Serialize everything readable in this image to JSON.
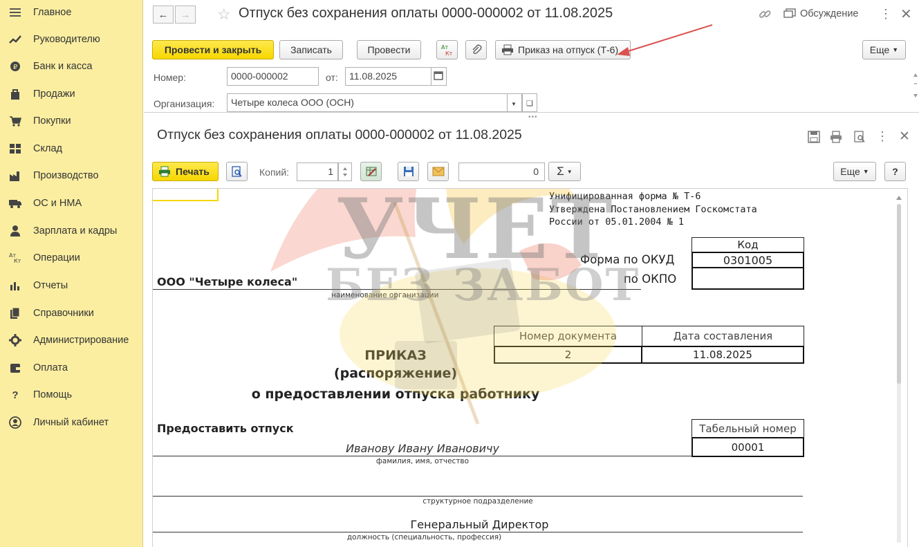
{
  "sidebar": {
    "items": [
      {
        "label": "Главное",
        "icon": "menu-lines-icon"
      },
      {
        "label": "Руководителю",
        "icon": "trend-icon"
      },
      {
        "label": "Банк и касса",
        "icon": "coin-icon"
      },
      {
        "label": "Продажи",
        "icon": "shopping-bag-icon"
      },
      {
        "label": "Покупки",
        "icon": "cart-icon"
      },
      {
        "label": "Склад",
        "icon": "warehouse-icon"
      },
      {
        "label": "Производство",
        "icon": "factory-icon"
      },
      {
        "label": "ОС и НМА",
        "icon": "truck-icon"
      },
      {
        "label": "Зарплата и кадры",
        "icon": "person-icon"
      },
      {
        "label": "Операции",
        "icon": "dt-kt-icon"
      },
      {
        "label": "Отчеты",
        "icon": "bar-chart-icon"
      },
      {
        "label": "Справочники",
        "icon": "books-icon"
      },
      {
        "label": "Администрирование",
        "icon": "gear-icon"
      },
      {
        "label": "Оплата",
        "icon": "wallet-icon"
      },
      {
        "label": "Помощь",
        "icon": "question-icon"
      },
      {
        "label": "Личный кабинет",
        "icon": "user-circle-icon"
      }
    ]
  },
  "document": {
    "title": "Отпуск без сохранения оплаты 0000-000002 от 11.08.2025",
    "discussion_label": "Обсуждение",
    "buttons": {
      "post_and_close": "Провести и закрыть",
      "save": "Записать",
      "post": "Провести",
      "print_order": "Приказ на отпуск (Т-6)",
      "more": "Еще"
    },
    "fields": {
      "number_label": "Номер:",
      "number_value": "0000-000002",
      "date_label": "от:",
      "date_value": "11.08.2025",
      "org_label": "Организация:",
      "org_value": "Четыре колеса ООО (ОСН)"
    }
  },
  "print_form": {
    "title": "Отпуск без сохранения оплаты 0000-000002 от 11.08.2025",
    "toolbar": {
      "print_label": "Печать",
      "copies_label": "Копий:",
      "copies_value": "1",
      "sum_value": "0",
      "sum_symbol": "Σ",
      "more": "Еще",
      "help": "?"
    },
    "sheet": {
      "form_header": [
        "Унифицированная форма № Т-6",
        "Утверждена Постановлением Госкомстата",
        "России от 05.01.2004 № 1"
      ],
      "code_header": "Код",
      "okud_label": "Форма по ОКУД",
      "okud_value": "0301005",
      "okpo_label": "по ОКПО",
      "okpo_value": "",
      "org_name": "ООО \"Четыре колеса\"",
      "org_caption": "наименование организации",
      "doc_number_header": "Номер документа",
      "doc_date_header": "Дата составления",
      "doc_number": "2",
      "doc_date": "11.08.2025",
      "order_title_1": "ПРИКАЗ",
      "order_title_2": "(распоряжение)",
      "order_title_3": "о предоставлении отпуска работнику",
      "grant_label": "Предоставить отпуск",
      "tab_number_header": "Табельный номер",
      "tab_number": "00001",
      "employee_name": "Иванову Ивану Ивановичу",
      "employee_caption": "фамилия, имя, отчество",
      "department_value": "",
      "department_caption": "структурное подразделение",
      "position_value": "Генеральный Директор",
      "position_caption": "должность (специальность, профессия)"
    }
  },
  "watermark": {
    "line1": "УЧЕТ",
    "line2": "БЕЗ ЗАБОТ"
  },
  "colors": {
    "sidebar_bg": "#fbeea1",
    "primary_button": "#f6d700",
    "annotation_arrow": "#d9534f"
  }
}
